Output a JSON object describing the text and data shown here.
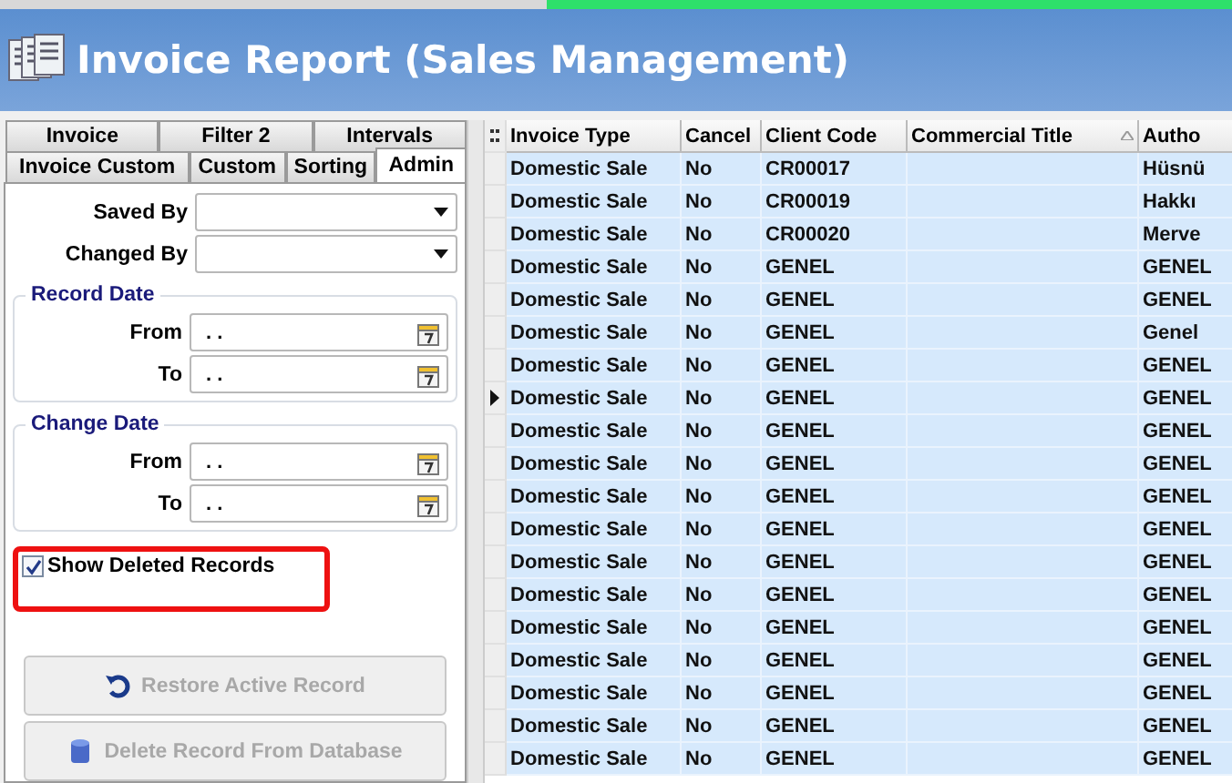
{
  "window": {
    "title": "Invoice Report (Sales Management)"
  },
  "tabs": [
    [
      {
        "label": "Invoice",
        "selected": false
      },
      {
        "label": "Filter 2",
        "selected": false
      },
      {
        "label": "Intervals",
        "selected": false
      }
    ],
    [
      {
        "label": "Invoice Custom",
        "selected": false
      },
      {
        "label": "Custom",
        "selected": false
      },
      {
        "label": "Sorting",
        "selected": false
      },
      {
        "label": "Admin",
        "selected": true
      }
    ]
  ],
  "combos": [
    {
      "label": "Saved By"
    },
    {
      "label": "Changed By"
    }
  ],
  "date_groups": [
    {
      "title": "Record Date",
      "fields": [
        {
          "label": "From",
          "value": ". ."
        },
        {
          "label": "To",
          "value": ". ."
        }
      ]
    },
    {
      "title": "Change Date",
      "fields": [
        {
          "label": "From",
          "value": ". ."
        },
        {
          "label": "To",
          "value": ". ."
        }
      ]
    }
  ],
  "show_deleted": {
    "label": "Show Deleted Records",
    "checked": true
  },
  "buttons": [
    {
      "label": "Restore Active Record",
      "disabled": true,
      "kind": "restore"
    },
    {
      "label": "Delete Record From Database",
      "disabled": true,
      "kind": "delete"
    }
  ],
  "table": {
    "columns": [
      "Invoice Type",
      "Cancel",
      "Client Code",
      "Commercial Title",
      "Autho"
    ],
    "rows": [
      {
        "cells": [
          "Domestic Sale",
          "No",
          "CR00017",
          "",
          "Hüsnü"
        ],
        "current": false
      },
      {
        "cells": [
          "Domestic Sale",
          "No",
          "CR00019",
          "",
          "Hakkı"
        ],
        "current": false
      },
      {
        "cells": [
          "Domestic Sale",
          "No",
          "CR00020",
          "",
          "Merve"
        ],
        "current": false
      },
      {
        "cells": [
          "Domestic Sale",
          "No",
          "GENEL",
          "",
          "GENEL"
        ],
        "current": false
      },
      {
        "cells": [
          "Domestic Sale",
          "No",
          "GENEL",
          "",
          "GENEL"
        ],
        "current": false
      },
      {
        "cells": [
          "Domestic Sale",
          "No",
          "GENEL",
          "",
          "Genel"
        ],
        "current": false
      },
      {
        "cells": [
          "Domestic Sale",
          "No",
          "GENEL",
          "",
          "GENEL"
        ],
        "current": false
      },
      {
        "cells": [
          "Domestic Sale",
          "No",
          "GENEL",
          "",
          "GENEL"
        ],
        "current": true
      },
      {
        "cells": [
          "Domestic Sale",
          "No",
          "GENEL",
          "",
          "GENEL"
        ],
        "current": false
      },
      {
        "cells": [
          "Domestic Sale",
          "No",
          "GENEL",
          "",
          "GENEL"
        ],
        "current": false
      },
      {
        "cells": [
          "Domestic Sale",
          "No",
          "GENEL",
          "",
          "GENEL"
        ],
        "current": false
      },
      {
        "cells": [
          "Domestic Sale",
          "No",
          "GENEL",
          "",
          "GENEL"
        ],
        "current": false
      },
      {
        "cells": [
          "Domestic Sale",
          "No",
          "GENEL",
          "",
          "GENEL"
        ],
        "current": false
      },
      {
        "cells": [
          "Domestic Sale",
          "No",
          "GENEL",
          "",
          "GENEL"
        ],
        "current": false
      },
      {
        "cells": [
          "Domestic Sale",
          "No",
          "GENEL",
          "",
          "GENEL"
        ],
        "current": false
      },
      {
        "cells": [
          "Domestic Sale",
          "No",
          "GENEL",
          "",
          "GENEL"
        ],
        "current": false
      },
      {
        "cells": [
          "Domestic Sale",
          "No",
          "GENEL",
          "",
          "GENEL"
        ],
        "current": false
      },
      {
        "cells": [
          "Domestic Sale",
          "No",
          "GENEL",
          "",
          "GENEL"
        ],
        "current": false
      },
      {
        "cells": [
          "Domestic Sale",
          "No",
          "GENEL",
          "",
          "GENEL"
        ],
        "current": false
      }
    ]
  }
}
